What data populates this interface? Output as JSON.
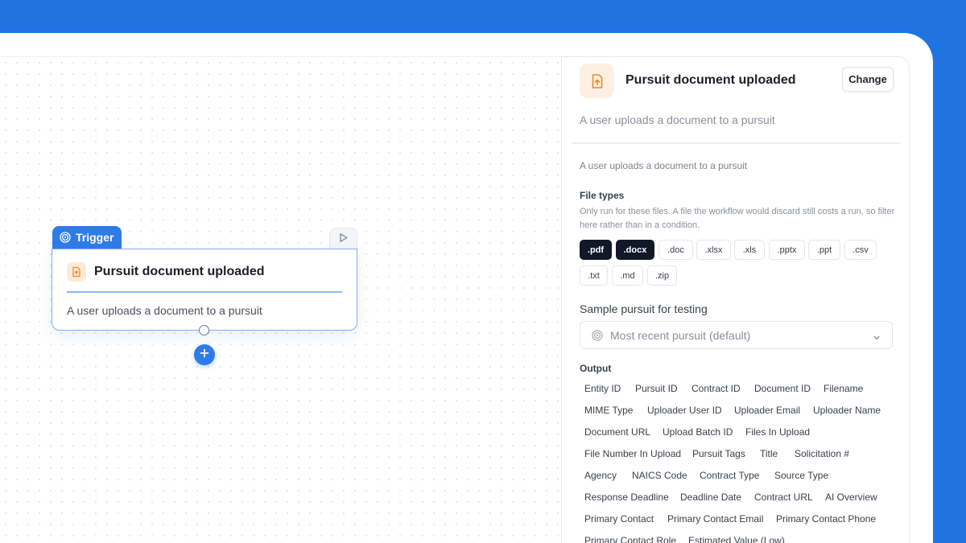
{
  "node": {
    "tab_label": "Trigger",
    "title": "Pursuit document uploaded",
    "description": "A user uploads a document to a pursuit",
    "tab_icon": "trigger-target-icon",
    "play_icon": "play-icon",
    "add_icon": "plus-icon",
    "document_icon": "document-upload-icon"
  },
  "panel": {
    "title": "Pursuit document uploaded",
    "change_label": "Change",
    "subtitle": "A user uploads a document to a pursuit",
    "description": "A user uploads a document to a pursuit",
    "file_types": {
      "label": "File types",
      "help": "Only run for these files. A file the workflow would discard still costs a run, so filter here rather than in a condition.",
      "options": [
        {
          "label": ".pdf",
          "selected": true
        },
        {
          "label": ".docx",
          "selected": true
        },
        {
          "label": ".doc",
          "selected": false
        },
        {
          "label": ".xlsx",
          "selected": false
        },
        {
          "label": ".xls",
          "selected": false
        },
        {
          "label": ".pptx",
          "selected": false
        },
        {
          "label": ".ppt",
          "selected": false
        },
        {
          "label": ".csv",
          "selected": false
        },
        {
          "label": ".txt",
          "selected": false
        },
        {
          "label": ".md",
          "selected": false
        },
        {
          "label": ".zip",
          "selected": false
        }
      ]
    },
    "sample": {
      "label": "Sample pursuit for testing",
      "value": "Most recent pursuit (default)"
    },
    "output": {
      "label": "Output",
      "fields": [
        "Entity ID",
        "Pursuit ID",
        "Contract ID",
        "Document ID",
        "Filename",
        "MIME Type",
        "Uploader User ID",
        "Uploader Email",
        "Uploader Name",
        "Document URL",
        "Upload Batch ID",
        "Files In Upload",
        "File Number In Upload",
        "Pursuit Tags",
        "Title",
        "Solicitation #",
        "Agency",
        "NAICS Code",
        "Contract Type",
        "Source Type",
        "Response Deadline",
        "Deadline Date",
        "Contract URL",
        "AI Overview",
        "Primary Contact",
        "Primary Contact Email",
        "Primary Contact Phone",
        "Primary Contact Role",
        "Estimated Value (Low)"
      ]
    }
  },
  "colors": {
    "accent": "#2f7be9",
    "background": "#1f74e2",
    "selected_chip": "#111827",
    "icon_orange": "#f08a24"
  }
}
